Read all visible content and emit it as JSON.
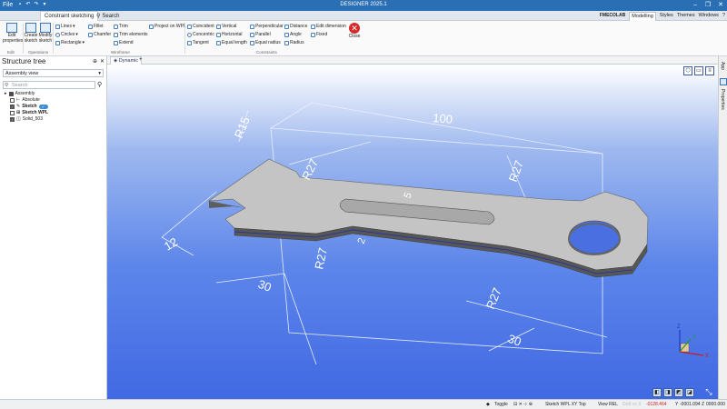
{
  "app": {
    "title": "DESIGNER 2025.1",
    "file_menu": "File",
    "window_controls": [
      "–",
      "❐",
      "✕"
    ]
  },
  "tabs": {
    "active": "Constraint sketching",
    "search_label": "Search",
    "brand": "FMECOLAB",
    "mode": "Modelling",
    "styles": "Styles",
    "themes": "Themes",
    "windows": "Windows",
    "help": "?"
  },
  "ribbon": {
    "edit_properties": "Edit properties",
    "create_sketch": "Create sketch",
    "modify_sketch": "Modify sketch",
    "lines": "Lines",
    "circles": "Circles",
    "rectangle": "Rectangle",
    "fillet": "Fillet",
    "chamfer": "Chamfer",
    "trim": "Trim",
    "trim_elements": "Trim elements",
    "extend": "Extend",
    "project_wpl": "Project on WPL",
    "coincident": "Coincident",
    "concentric": "Concentric",
    "tangent": "Tangent",
    "vertical": "Vertical",
    "horizontal": "Horizontal",
    "equal_length": "Equal length",
    "perpendicular": "Perpendicular",
    "parallel": "Parallel",
    "equal_radius": "Equal radius",
    "distance": "Distance",
    "angle": "Angle",
    "radius": "Radius",
    "edit_dimension": "Edit dimension",
    "fixed": "Fixed",
    "close": "Close",
    "groups": {
      "edit": "Edit",
      "operations": "Operations",
      "wireframe": "Wireframe",
      "constraints": "Constraints"
    }
  },
  "structure": {
    "title": "Structure tree",
    "pin": "⊕",
    "close": "✕",
    "view_select": "Assembly view",
    "search_placeholder": "Search",
    "filter_icon": "⚲",
    "items": [
      {
        "label": "Assembly",
        "checked": true
      },
      {
        "label": "Absolute",
        "checked": false
      },
      {
        "label": "Sketch",
        "checked": true,
        "badge": "✓"
      },
      {
        "label": "Sketch WPL",
        "checked": false
      },
      {
        "label": "Solid_503",
        "checked": true
      }
    ]
  },
  "viewport": {
    "tab": "Dynamic",
    "add": "+",
    "dims": {
      "d100": "100",
      "r15": "R15",
      "r27a": "R27",
      "r27b": "R27",
      "r27c": "R27",
      "r27d": "R27",
      "d12": "12",
      "d30a": "30",
      "d30b": "30",
      "d5": "5",
      "d2": "2"
    },
    "axis": {
      "x": "X",
      "y": "Y",
      "z": "Z"
    }
  },
  "right_panel": {
    "app": "App",
    "properties": "Properties"
  },
  "status": {
    "toggle": "Toggle",
    "sketch_wpl": "Sketch WPL XY Top",
    "view": "View REL",
    "coords_prefix": "Grid vs X",
    "x_val": "-0128.464",
    "y_label": "Y",
    "y_val": "-0001.094",
    "z_label": "Z",
    "z_val": "0000.000"
  },
  "colors": {
    "accent": "#2a6eb4",
    "viewport_bottom": "#4169e3",
    "close_red": "#d62a2a",
    "sketch_lines": "#e8eefc"
  }
}
